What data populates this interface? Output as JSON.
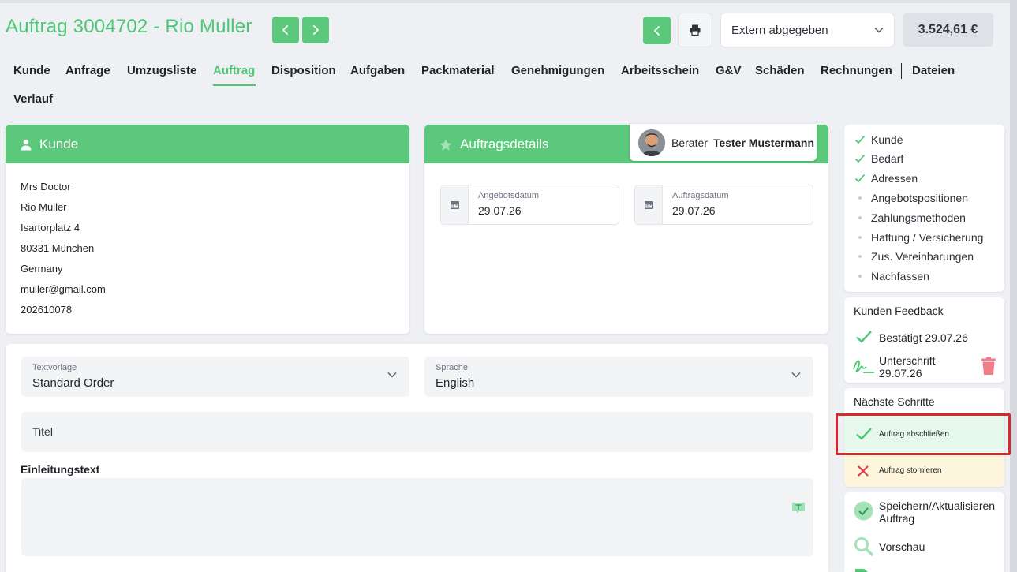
{
  "header": {
    "title": "Auftrag 3004702 - Rio Muller",
    "status": "Extern abgegeben",
    "total": "3.524,61 €"
  },
  "tabs": [
    "Kunde",
    "Anfrage",
    "Umzugsliste",
    "Auftrag",
    "Disposition",
    "Aufgaben",
    "Packmaterial",
    "Genehmigungen",
    "Arbeitsschein",
    "G&V",
    "Schäden",
    "Rechnungen",
    "Dateien",
    "Verlauf"
  ],
  "active_tab": "Auftrag",
  "kunde": {
    "heading": "Kunde",
    "lines": [
      "Mrs Doctor",
      "Rio Muller",
      "Isartorplatz 4",
      "80331 München",
      "Germany",
      "muller@gmail.com",
      "202610078"
    ]
  },
  "auftragsdetails": {
    "heading": "Auftragsdetails",
    "berater_label": "Berater",
    "berater_name": "Tester Mustermann",
    "angebotsdatum_label": "Angebotsdatum",
    "angebotsdatum": "29.07.26",
    "auftragsdatum_label": "Auftragsdatum",
    "auftragsdatum": "29.07.26"
  },
  "form": {
    "textvorlage_label": "Textvorlage",
    "textvorlage": "Standard Order",
    "sprache_label": "Sprache",
    "sprache": "English",
    "titel_placeholder": "Titel",
    "einleitung_label": "Einleitungstext"
  },
  "checklist": [
    {
      "label": "Kunde",
      "done": true
    },
    {
      "label": "Bedarf",
      "done": true
    },
    {
      "label": "Adressen",
      "done": true
    },
    {
      "label": "Angebotspositionen",
      "done": false
    },
    {
      "label": "Zahlungsmethoden",
      "done": false
    },
    {
      "label": "Haftung / Versicherung",
      "done": false
    },
    {
      "label": "Zus. Vereinbarungen",
      "done": false
    },
    {
      "label": "Nachfassen",
      "done": false
    }
  ],
  "feedback": {
    "title": "Kunden Feedback",
    "bestaetigt": "Bestätigt 29.07.26",
    "unterschrift_line1": "Unterschrift",
    "unterschrift_line2": "29.07.26"
  },
  "next_steps": {
    "title": "Nächste Schritte",
    "abschliessen": "Auftrag abschließen",
    "stornieren": "Auftrag stornieren"
  },
  "actions": {
    "speichern_line1": "Speichern/Aktualisieren",
    "speichern_line2": "Auftrag",
    "vorschau": "Vorschau"
  },
  "colors": {
    "accent": "#5cc87b",
    "accent_text": "#4cc774",
    "highlight_border": "#d42a2a",
    "abschliessen_bg": "#e6f8ec",
    "stornieren_bg": "#fdf6dc",
    "delete": "#f27c8a"
  }
}
